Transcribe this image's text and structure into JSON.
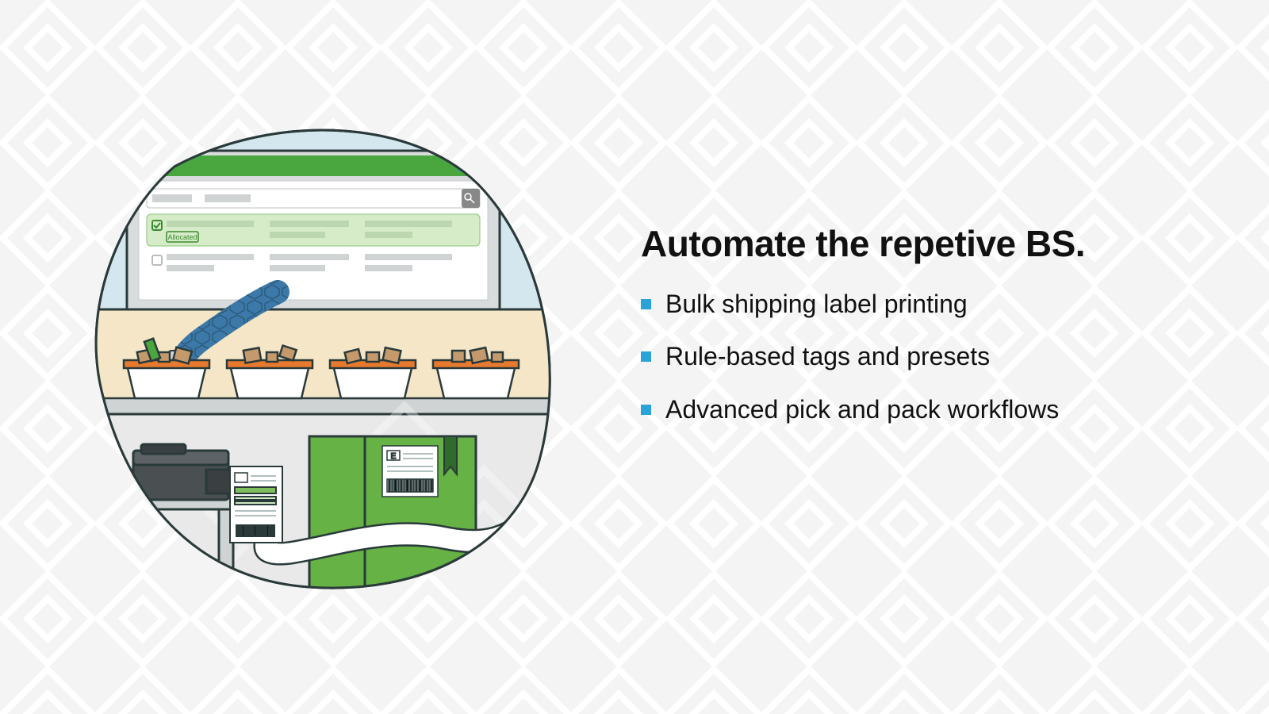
{
  "headline": "Automate the repetive BS.",
  "bullets": [
    "Bulk shipping label printing",
    "Rule-based tags and presets",
    "Advanced pick and pack workflows"
  ],
  "illustration": {
    "tag_label": "Allocated",
    "colors": {
      "accent_blue": "#2aa3d9",
      "green_bar": "#4aa63f",
      "green_light": "#d6ecc9",
      "box_green": "#66b244",
      "bin_orange": "#e77a2e",
      "sky": "#d5e7ee",
      "beige": "#f4e6c7",
      "floor": "#e9e9e9",
      "arm_blue": "#3c78a8",
      "outline": "#2a3a3a"
    }
  }
}
